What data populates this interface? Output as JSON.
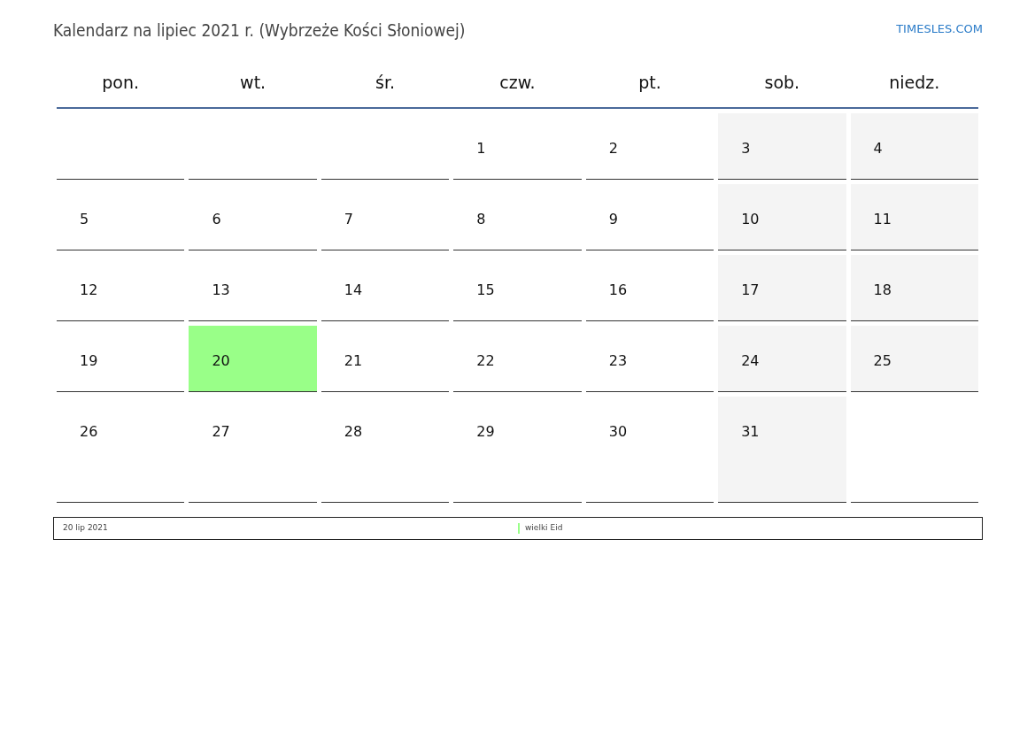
{
  "title": "Kalendarz na lipiec 2021 r. (Wybrzeże Kości Słoniowej)",
  "site_link": "TIMESLES.COM",
  "weekdays": [
    "pon.",
    "wt.",
    "śr.",
    "czw.",
    "pt.",
    "sob.",
    "niedz."
  ],
  "weeks": [
    [
      {
        "kind": "weekday"
      },
      {
        "kind": "weekday"
      },
      {
        "kind": "weekday"
      },
      {
        "kind": "weekday",
        "day": "1"
      },
      {
        "kind": "weekday",
        "day": "2"
      },
      {
        "kind": "weekend",
        "day": "3"
      },
      {
        "kind": "weekend",
        "day": "4"
      }
    ],
    [
      {
        "kind": "weekday",
        "day": "5"
      },
      {
        "kind": "weekday",
        "day": "6"
      },
      {
        "kind": "weekday",
        "day": "7"
      },
      {
        "kind": "weekday",
        "day": "8"
      },
      {
        "kind": "weekday",
        "day": "9"
      },
      {
        "kind": "weekend",
        "day": "10"
      },
      {
        "kind": "weekend",
        "day": "11"
      }
    ],
    [
      {
        "kind": "weekday",
        "day": "12"
      },
      {
        "kind": "weekday",
        "day": "13"
      },
      {
        "kind": "weekday",
        "day": "14"
      },
      {
        "kind": "weekday",
        "day": "15"
      },
      {
        "kind": "weekday",
        "day": "16"
      },
      {
        "kind": "weekend",
        "day": "17"
      },
      {
        "kind": "weekend",
        "day": "18"
      }
    ],
    [
      {
        "kind": "weekday",
        "day": "19"
      },
      {
        "kind": "holiday",
        "day": "20"
      },
      {
        "kind": "weekday",
        "day": "21"
      },
      {
        "kind": "weekday",
        "day": "22"
      },
      {
        "kind": "weekday",
        "day": "23"
      },
      {
        "kind": "weekend",
        "day": "24"
      },
      {
        "kind": "weekend",
        "day": "25"
      }
    ],
    [
      {
        "kind": "weekday",
        "day": "26"
      },
      {
        "kind": "weekday",
        "day": "27"
      },
      {
        "kind": "weekday",
        "day": "28"
      },
      {
        "kind": "weekday",
        "day": "29"
      },
      {
        "kind": "weekday",
        "day": "30"
      },
      {
        "kind": "weekend",
        "day": "31"
      },
      {
        "kind": "weekday"
      }
    ]
  ],
  "holidays": [
    {
      "date": "20 lip 2021",
      "name": "wielki Eid",
      "color": "#99ff88"
    }
  ]
}
